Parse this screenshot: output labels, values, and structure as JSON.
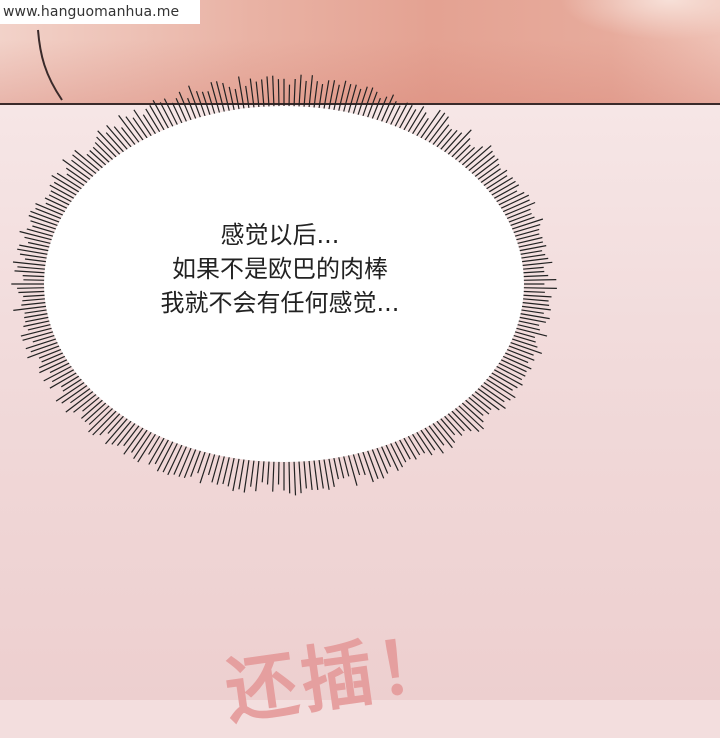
{
  "watermark": {
    "text": "www.hanguomanhua.me"
  },
  "speech_bubble": {
    "lines": [
      "感觉以后...",
      "如果不是欧巴的肉棒",
      "我就不会有任何感觉..."
    ]
  },
  "sound_effect": {
    "text": "还插！"
  },
  "colors": {
    "top_panel": "#e4a292",
    "bottom_panel": "#f1dada",
    "bubble_fill": "#ffffff",
    "burst_lines": "#222222",
    "sound_effect": "#e59a9a"
  }
}
